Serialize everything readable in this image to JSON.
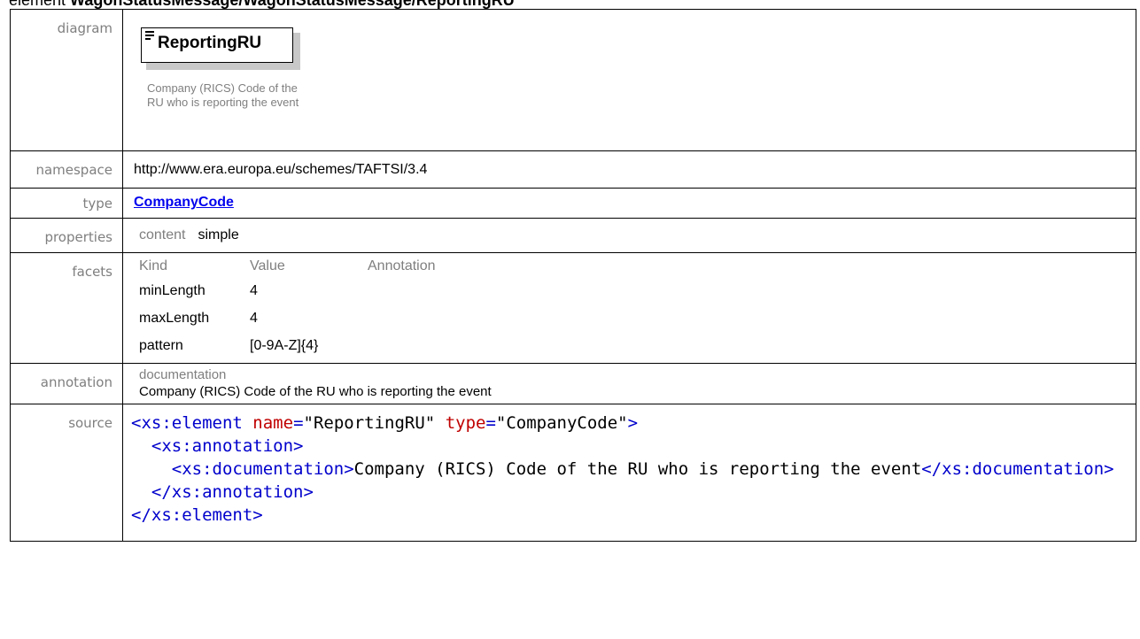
{
  "heading": {
    "prefix": "element ",
    "path": "WagonStatusMessage/WagonStatusMessage/ReportingRU"
  },
  "labels": {
    "diagram": "diagram",
    "namespace": "namespace",
    "type": "type",
    "properties": "properties",
    "facets": "facets",
    "annotation": "annotation",
    "source": "source"
  },
  "diagram": {
    "element_name": "ReportingRU",
    "documentation": "Company (RICS) Code of the RU who is reporting the event"
  },
  "namespace": "http://www.era.europa.eu/schemes/TAFTSI/3.4",
  "type": "CompanyCode",
  "properties": {
    "key": "content",
    "value": "simple"
  },
  "facets": {
    "headers": [
      "Kind",
      "Value",
      "Annotation"
    ],
    "rows": [
      {
        "kind": "minLength",
        "value": "4",
        "annotation": ""
      },
      {
        "kind": "maxLength",
        "value": "4",
        "annotation": ""
      },
      {
        "kind": "pattern",
        "value": "[0-9A-Z]{4}",
        "annotation": ""
      }
    ]
  },
  "annotation": {
    "key": "documentation",
    "text": "Company (RICS) Code of the RU who is reporting the event"
  },
  "source": {
    "l1_open": "<xs:element",
    "l1_name_attr": "name",
    "l1_name_val": "\"ReportingRU\"",
    "l1_type_attr": "type",
    "l1_type_val": "\"CompanyCode\"",
    "l1_close": ">",
    "l2": "<xs:annotation>",
    "l3_open": "<xs:documentation>",
    "l3_text": "Company (RICS) Code of the RU who is reporting the event",
    "l3_close": "</xs:documentation>",
    "l4": "</xs:annotation>",
    "l5": "</xs:element>"
  },
  "colors": {
    "tag": "#0000cc",
    "attr": "#c00000",
    "link": "#0000ee",
    "label": "#7f7f7f"
  }
}
